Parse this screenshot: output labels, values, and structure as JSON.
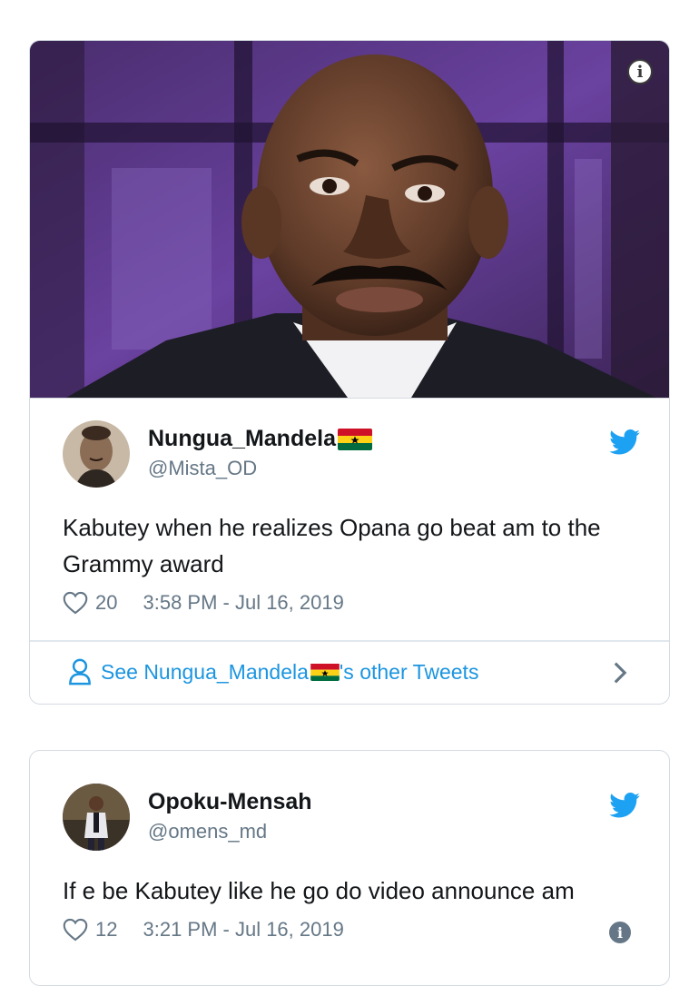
{
  "tweets": [
    {
      "author": {
        "name": "Nungua_Mandela",
        "handle": "@Mista_OD",
        "name_flag": "ghana-flag"
      },
      "media": {
        "description": "photo",
        "info_icon": "info-icon"
      },
      "text": "Kabutey when he realizes Opana go beat am to the Grammy award",
      "likes": "20",
      "timestamp": "3:58 PM - Jul 16, 2019",
      "see_more": {
        "prefix": "See Nungua_Mandela",
        "suffix": "'s other Tweets",
        "icon": "person-icon"
      }
    },
    {
      "author": {
        "name": "Opoku-Mensah",
        "handle": "@omens_md"
      },
      "text": "If e be Kabutey like he go do video announce am",
      "likes": "12",
      "timestamp": "3:21 PM - Jul 16, 2019",
      "info_icon": "info-icon"
    }
  ],
  "colors": {
    "twitter_blue": "#1da1f2",
    "link_blue": "#1b95e0",
    "muted_text": "#657786",
    "primary_text": "#14171a",
    "border": "#d4dbe1"
  }
}
